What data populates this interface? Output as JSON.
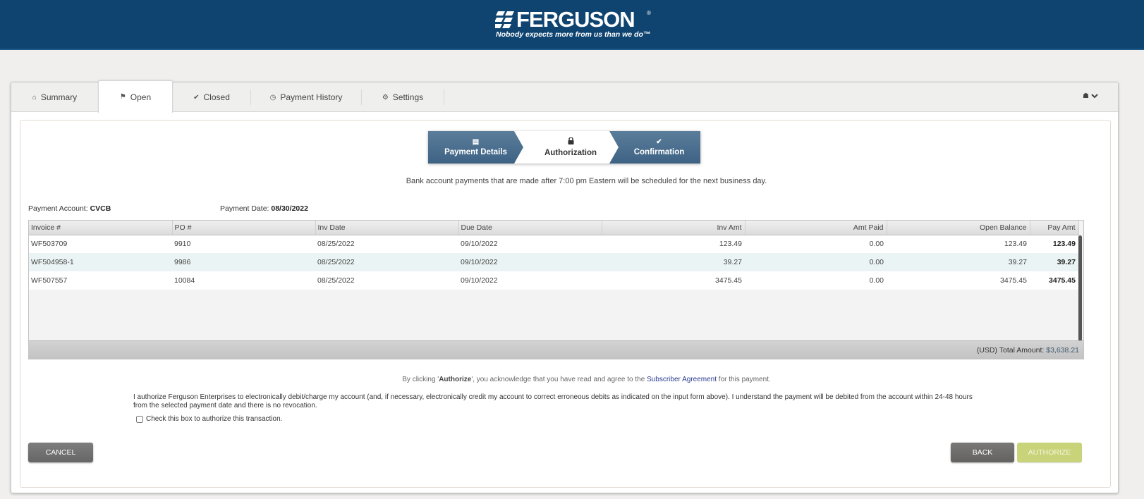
{
  "brand": {
    "name": "FERGUSON",
    "registered": "®",
    "tagline": "Nobody expects more from us than we do™",
    "header_color": "#0f4470"
  },
  "tabs": [
    {
      "label": "Summary",
      "icon": "home-icon",
      "glyph": "⌂",
      "active": false
    },
    {
      "label": "Open",
      "icon": "flag-icon",
      "glyph": "⚑",
      "active": true
    },
    {
      "label": "Closed",
      "icon": "check-icon",
      "glyph": "✔",
      "active": false
    },
    {
      "label": "Payment History",
      "icon": "clock-icon",
      "glyph": "◷",
      "active": false
    },
    {
      "label": "Settings",
      "icon": "gear-icon",
      "glyph": "⚙",
      "active": false
    }
  ],
  "user_menu": {
    "icon": "user-icon",
    "glyph": "☗",
    "chevron": "⌄"
  },
  "wizard": {
    "steps": [
      {
        "label": "Payment Details",
        "icon": "document-icon",
        "glyph": "▤",
        "state": "done"
      },
      {
        "label": "Authorization",
        "icon": "lock-icon",
        "glyph": "🔒︎",
        "state": "current"
      },
      {
        "label": "Confirmation",
        "icon": "check-icon",
        "glyph": "✔",
        "state": "pending"
      }
    ]
  },
  "notice": "Bank account payments that are made after 7:00 pm Eastern will be scheduled for the next business day.",
  "payment_account": {
    "label": "Payment Account:",
    "value": "CVCB"
  },
  "payment_date": {
    "label": "Payment Date:",
    "value": "08/30/2022"
  },
  "table": {
    "columns": [
      "Invoice #",
      "PO #",
      "Inv Date",
      "Due Date",
      "Inv Amt",
      "Amt Paid",
      "Open Balance",
      "Pay Amt"
    ],
    "rows": [
      {
        "invoice": "WF503709",
        "po": "9910",
        "inv_date": "08/25/2022",
        "due_date": "09/10/2022",
        "inv_amt": "123.49",
        "amt_paid": "0.00",
        "open_balance": "123.49",
        "pay_amt": "123.49"
      },
      {
        "invoice": "WF504958-1",
        "po": "9986",
        "inv_date": "08/25/2022",
        "due_date": "09/10/2022",
        "inv_amt": "39.27",
        "amt_paid": "0.00",
        "open_balance": "39.27",
        "pay_amt": "39.27"
      },
      {
        "invoice": "WF507557",
        "po": "10084",
        "inv_date": "08/25/2022",
        "due_date": "09/10/2022",
        "inv_amt": "3475.45",
        "amt_paid": "0.00",
        "open_balance": "3475.45",
        "pay_amt": "3475.45"
      }
    ],
    "footer_label": "(USD) Total Amount:",
    "total": "$3,638.21"
  },
  "agreement": {
    "prefix": "By clicking '",
    "keyword": "Authorize",
    "middle": "', you acknowledge that you have read and agree to the ",
    "link": "Subscriber Agreement",
    "suffix": " for this payment."
  },
  "authorization_text": "I authorize Ferguson Enterprises to electronically debit/charge my account (and, if necessary, electronically credit my account to correct erroneous debits as indicated on the input form above). I understand the payment will be debited from the account within 24-48 hours from the selected payment date and there is no revocation.",
  "checkbox": {
    "label": "Check this box to authorize this transaction.",
    "checked": false
  },
  "buttons": {
    "cancel": "CANCEL",
    "back": "BACK",
    "authorize": "AUTHORIZE"
  },
  "colors": {
    "authorize_disabled": "#c8d37a",
    "wizard_step": "#4a6e8e",
    "link": "#2a3b8f"
  }
}
